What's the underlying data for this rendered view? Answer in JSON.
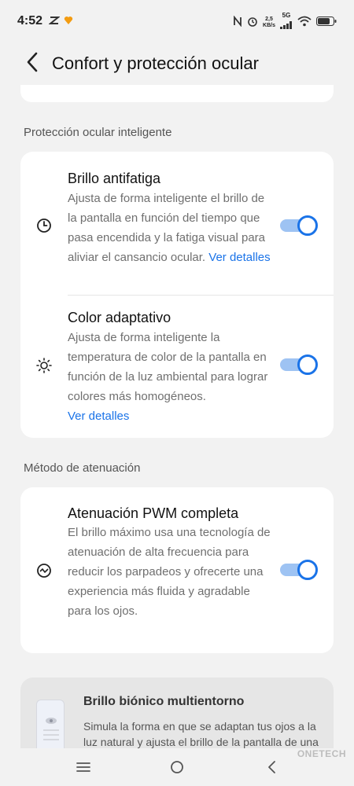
{
  "status_bar": {
    "time": "4:52",
    "net_speed_value": "2,5",
    "net_speed_unit": "KB/s",
    "network_type": "5G",
    "icons": [
      "notification-icon",
      "heart-app-icon",
      "nfc-icon",
      "alarm-icon",
      "signal-icon",
      "wifi-icon",
      "battery-icon"
    ]
  },
  "header": {
    "title": "Confort y protección ocular",
    "back_icon": "back-arrow-icon"
  },
  "sections": {
    "smart_protection": {
      "label": "Protección ocular inteligente",
      "items": [
        {
          "title": "Brillo antifatiga",
          "description": "Ajusta de forma inteligente el brillo de la pantalla en función del tiempo que pasa encendida y la fatiga visual para aliviar el cansancio ocular.",
          "link": "Ver detalles",
          "icon": "clock-icon",
          "enabled": true
        },
        {
          "title": "Color adaptativo",
          "description": "Ajusta de forma inteligente la temperatura de color de la pantalla en función de la luz ambiental para lograr colores más homogéneos.",
          "link": "Ver detalles",
          "icon": "sun-icon",
          "enabled": true
        }
      ]
    },
    "dimming": {
      "label": "Método de atenuación",
      "items": [
        {
          "title": "Atenuación PWM completa",
          "description": "El brillo máximo usa una tecnología de atenuación de alta frecuencia para reducir los parpadeos y ofrecerte una experiencia más fluida y agradable para los ojos.",
          "icon": "pulse-icon",
          "enabled": true
        }
      ]
    },
    "bionic": {
      "title": "Brillo biónico multientorno",
      "description": "Simula la forma en que se adaptan tus ojos a la luz natural y ajusta el brillo de la pantalla de una"
    }
  },
  "nav_bar": {
    "icons": [
      "menu-icon",
      "home-icon",
      "back-icon"
    ]
  },
  "watermark": "ONETECH",
  "colors": {
    "accent": "#1a73e8",
    "toggle_track": "#9ec3f3",
    "background": "#f2f2f2",
    "card": "#ffffff"
  }
}
